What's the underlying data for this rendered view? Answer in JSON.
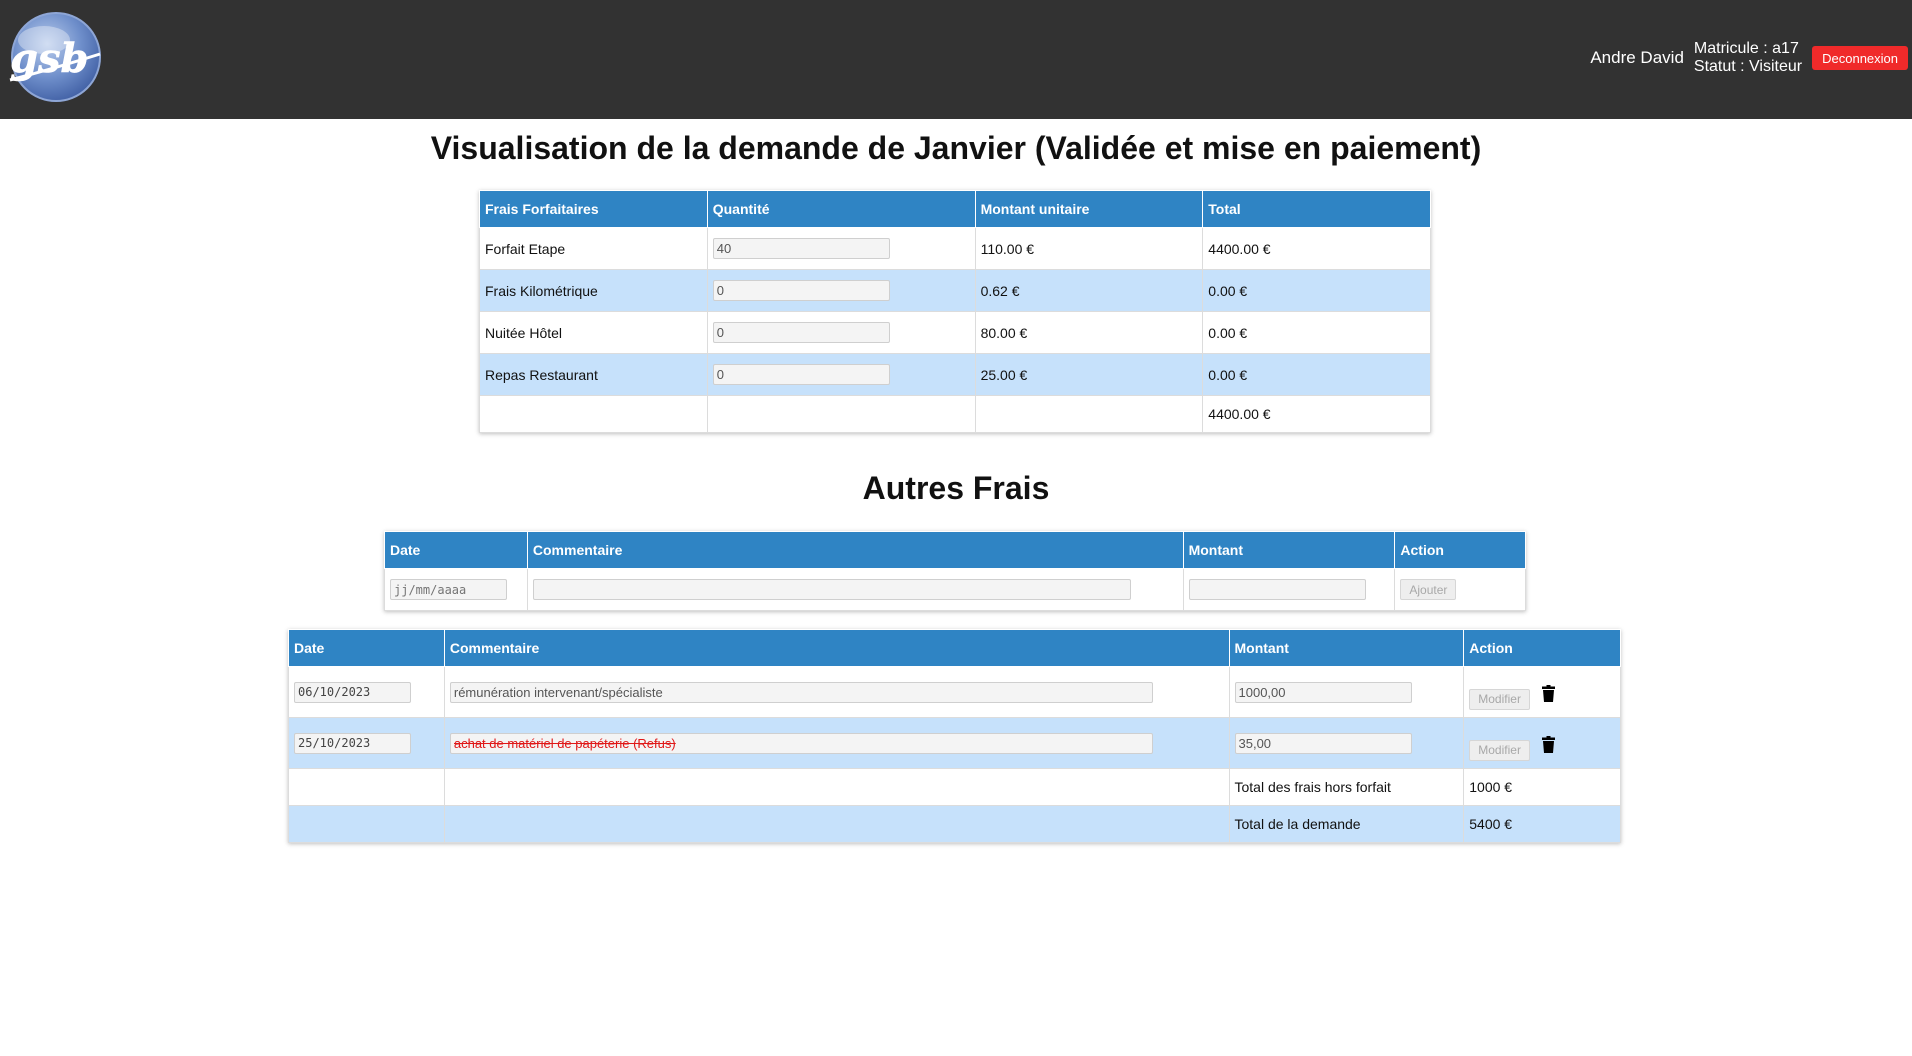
{
  "header": {
    "logo_text": "gsb",
    "user_name": "Andre David",
    "matricule": "Matricule : a17",
    "statut": "Statut : Visiteur",
    "logout_label": "Deconnexion"
  },
  "page_title": "Visualisation de la demande de Janvier (Validée et mise en paiement)",
  "forfait_table": {
    "headers": [
      "Frais Forfaitaires",
      "Quantité",
      "Montant unitaire",
      "Total"
    ],
    "rows": [
      {
        "label": "Forfait Etape",
        "quantity": "40",
        "unit": "110.00 €",
        "total": "4400.00 €"
      },
      {
        "label": "Frais Kilométrique",
        "quantity": "0",
        "unit": "0.62 €",
        "total": "0.00 €"
      },
      {
        "label": "Nuitée Hôtel",
        "quantity": "0",
        "unit": "80.00 €",
        "total": "0.00 €"
      },
      {
        "label": "Repas Restaurant",
        "quantity": "0",
        "unit": "25.00 €",
        "total": "0.00 €"
      }
    ],
    "grand_total": "4400.00 €"
  },
  "autres_frais_title": "Autres Frais",
  "add_table": {
    "headers": [
      "Date",
      "Commentaire",
      "Montant",
      "Action"
    ],
    "date_placeholder": "jj/mm/aaaa",
    "add_label": "Ajouter"
  },
  "hors_forfait_table": {
    "headers": [
      "Date",
      "Commentaire",
      "Montant",
      "Action"
    ],
    "rows": [
      {
        "date": "06/10/2023",
        "comment": "rémunération intervenant/spécialiste",
        "amount": "1000,00",
        "modify_label": "Modifier",
        "refused": false
      },
      {
        "date": "25/10/2023",
        "comment": "achat de matériel de papéterie (Refus)",
        "amount": "35,00",
        "modify_label": "Modifier",
        "refused": true
      }
    ],
    "total_hors_forfait_label": "Total des frais hors forfait",
    "total_hors_forfait": "1000 €",
    "total_demande_label": "Total de la demande",
    "total_demande": "5400 €"
  },
  "colors": {
    "header_bg": "#323232",
    "table_header_bg": "#2f84c4",
    "row_alt_bg": "#c6e1fb",
    "logout_bg": "#f02a2a",
    "refused_text": "#e01818"
  },
  "icons": [
    "gsb-logo",
    "trash-icon"
  ]
}
